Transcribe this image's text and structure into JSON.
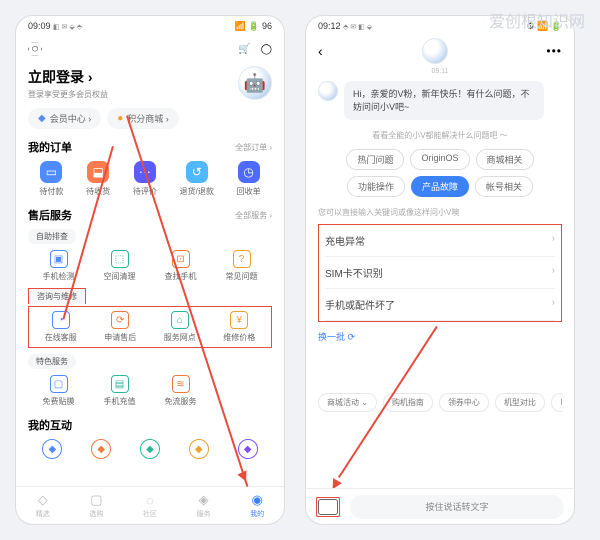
{
  "watermark": "爱创根知识网",
  "phone1": {
    "status": {
      "time": "09:09",
      "icons": "◧ ✉ ⬙ ⬘",
      "right": "📶 🔋 96"
    },
    "top": {
      "cart": "🛒"
    },
    "login": {
      "title": "立即登录 ›",
      "sub": "登录享受更多会员权益"
    },
    "chips": [
      {
        "icon": "◆",
        "label": "会员中心 ›",
        "color": "#5b8def"
      },
      {
        "icon": "●",
        "label": "积分商城 ›",
        "color": "#f0a030"
      }
    ],
    "orders": {
      "title": "我的订单",
      "link": "全部订单 ›",
      "items": [
        {
          "label": "待付款",
          "bg": "#4f8bff",
          "icon": "▭"
        },
        {
          "label": "待收货",
          "bg": "#ff7b4f",
          "icon": "⬓"
        },
        {
          "label": "待评价",
          "bg": "#5b5bff",
          "icon": "⋯"
        },
        {
          "label": "退货/退款",
          "bg": "#4fb8ff",
          "icon": "↺"
        },
        {
          "label": "回收单",
          "bg": "#4f6bff",
          "icon": "◷"
        }
      ]
    },
    "service": {
      "title": "售后服务",
      "link": "全部服务 ›",
      "group1_title": "自助排查",
      "group1": [
        {
          "label": "手机检测",
          "icon": "▣",
          "color": "#4f8bff"
        },
        {
          "label": "空间清理",
          "icon": "⬚",
          "color": "#2bb89a"
        },
        {
          "label": "查找手机",
          "icon": "⊡",
          "color": "#f07b3c"
        },
        {
          "label": "常见问题",
          "icon": "?",
          "color": "#f0a030"
        }
      ],
      "group2_title": "咨询与维修",
      "group2": [
        {
          "label": "在线客服",
          "icon": "◔",
          "color": "#4f8bff"
        },
        {
          "label": "申请售后",
          "icon": "⟳",
          "color": "#f07b3c"
        },
        {
          "label": "服务网点",
          "icon": "⌂",
          "color": "#2bb89a"
        },
        {
          "label": "维修价格",
          "icon": "¥",
          "color": "#f0a030"
        }
      ],
      "group3_title": "特色服务",
      "group3": [
        {
          "label": "免费贴膜",
          "icon": "▢",
          "color": "#4f8bff"
        },
        {
          "label": "手机充值",
          "icon": "▤",
          "color": "#2bb89a"
        },
        {
          "label": "免流服务",
          "icon": "≋",
          "color": "#f07b3c"
        }
      ]
    },
    "interact": {
      "title": "我的互动",
      "items": [
        {
          "color": "#4f8bff"
        },
        {
          "color": "#f07b3c"
        },
        {
          "color": "#2bb89a"
        },
        {
          "color": "#f0a030"
        },
        {
          "color": "#7b4fff"
        }
      ]
    },
    "nav": [
      {
        "label": "精选",
        "icon": "◇"
      },
      {
        "label": "选购",
        "icon": "▢"
      },
      {
        "label": "社区",
        "icon": "◌"
      },
      {
        "label": "服务",
        "icon": "◈"
      },
      {
        "label": "我的",
        "icon": "◉",
        "active": true
      }
    ]
  },
  "phone2": {
    "status": {
      "time": "09:12",
      "icons": "⬘ ✉ ◧ ⬙",
      "right": "⚙ 📶 🔋"
    },
    "timestamp": "09:11",
    "message": "Hi，亲爱的V粉，新年快乐！有什么问题，不妨问问小V吧~",
    "hint1": "看看全能的小V都能解决什么问题吧 ～",
    "tags": [
      {
        "label": "热门问题"
      },
      {
        "label": "OriginOS"
      },
      {
        "label": "商城相关"
      },
      {
        "label": "功能操作"
      },
      {
        "label": "产品故障",
        "active": true
      },
      {
        "label": "帐号相关"
      }
    ],
    "hint2": "您可以直接输入关键词或像这样问小V噢",
    "faqs": [
      "充电异常",
      "SIM卡不识别",
      "手机或配件坏了"
    ],
    "refresh": "换一批 ⟳",
    "quick": [
      "商城活动 ⌄",
      "购机指南",
      "领券中心",
      "机型对比",
      "以"
    ],
    "voice_placeholder": "按住说话转文字"
  }
}
